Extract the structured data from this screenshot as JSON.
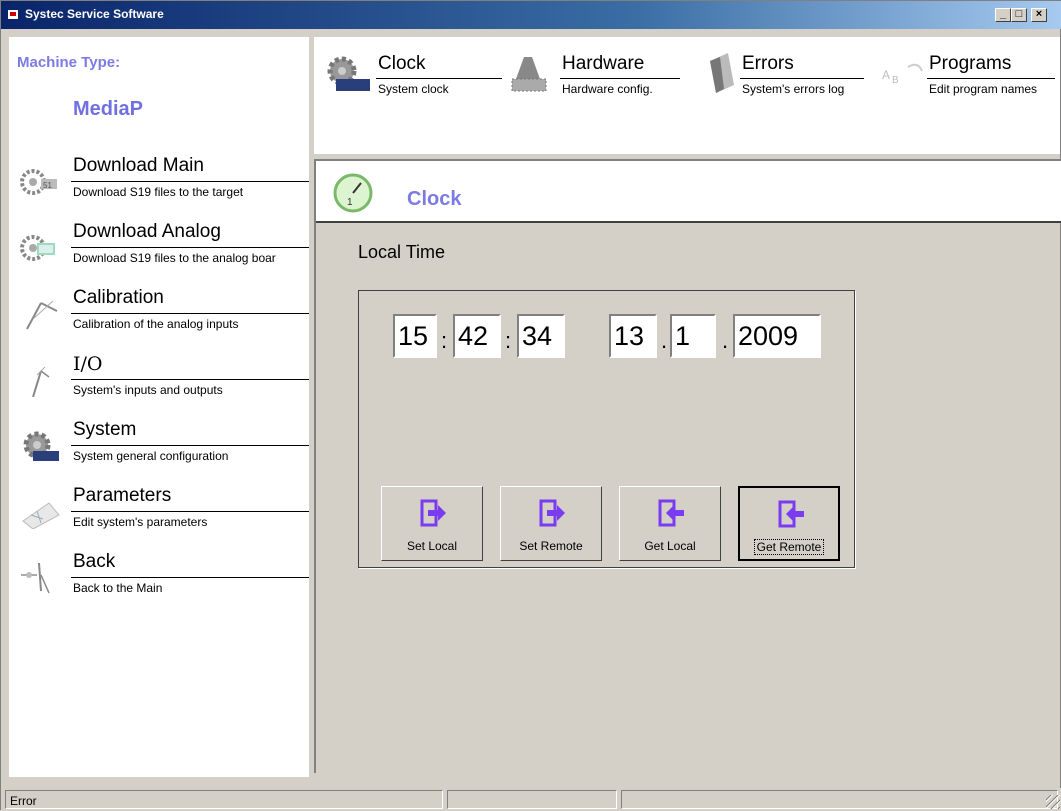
{
  "window": {
    "title": "Systec Service Software"
  },
  "sidebar": {
    "machine_type_label": "Machine Type:",
    "machine_type_value": "MediaP",
    "items": [
      {
        "title": "Download Main",
        "subtitle": "Download S19 files to the target",
        "icon": "download-gears-icon"
      },
      {
        "title": "Download Analog",
        "subtitle": "Download S19 files to the analog boar",
        "icon": "download-analog-icon"
      },
      {
        "title": "Calibration",
        "subtitle": "Calibration of the analog inputs",
        "icon": "calibration-compass-icon"
      },
      {
        "title": "I/O",
        "subtitle": "System's inputs and outputs",
        "icon": "io-icon"
      },
      {
        "title": "System",
        "subtitle": "System general configuration",
        "icon": "gear-icon"
      },
      {
        "title": "Parameters",
        "subtitle": "Edit system's parameters",
        "icon": "parameters-icon"
      },
      {
        "title": "Back",
        "subtitle": "Back to the Main",
        "icon": "back-icon"
      }
    ]
  },
  "toolbar": {
    "items": [
      {
        "title": "Clock",
        "subtitle": "System clock",
        "icon": "gear-clock-icon"
      },
      {
        "title": "Hardware",
        "subtitle": "Hardware config.",
        "icon": "hardware-icon"
      },
      {
        "title": "Errors",
        "subtitle": "System's errors log",
        "icon": "errors-icon"
      },
      {
        "title": "Programs",
        "subtitle": "Edit program names",
        "icon": "programs-icon"
      }
    ]
  },
  "panel": {
    "header_title": "Clock",
    "local_time_label": "Local Time",
    "time": {
      "hour": "15",
      "minute": "42",
      "second": "34"
    },
    "date": {
      "day": "13",
      "month": "1",
      "year": "2009"
    },
    "time_separator": ":",
    "date_separator": ".",
    "buttons": [
      {
        "label": "Set Local",
        "icon": "export-icon"
      },
      {
        "label": "Set Remote",
        "icon": "export-icon"
      },
      {
        "label": "Get Local",
        "icon": "import-icon"
      },
      {
        "label": "Get Remote",
        "icon": "import-icon"
      }
    ]
  },
  "statusbar": {
    "pane1": "Error",
    "pane2": "",
    "pane3": ""
  },
  "colors": {
    "accent_text": "#7b7be3",
    "button_icon": "#7b3bf0",
    "title_bar": "#0a246a"
  }
}
